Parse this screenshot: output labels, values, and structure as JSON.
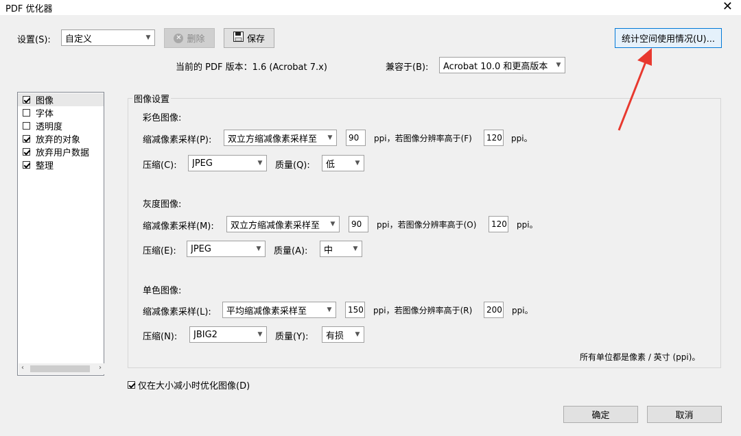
{
  "window": {
    "title": "PDF 优化器",
    "close_glyph": "✕"
  },
  "top": {
    "settings_label": "设置(S):",
    "settings_value": "自定义",
    "delete_label": "删除",
    "save_label": "保存",
    "audit_label": "统计空间使用情况(U)...",
    "current_version": "当前的 PDF 版本：1.6 (Acrobat 7.x)",
    "compat_label": "兼容于(B):",
    "compat_value": "Acrobat 10.0 和更高版本"
  },
  "panels": [
    {
      "label": "图像",
      "checked": true,
      "selected": true
    },
    {
      "label": "字体",
      "checked": false,
      "selected": false
    },
    {
      "label": "透明度",
      "checked": false,
      "selected": false
    },
    {
      "label": "放弃的对象",
      "checked": true,
      "selected": false
    },
    {
      "label": "放弃用户数据",
      "checked": true,
      "selected": false
    },
    {
      "label": "整理",
      "checked": true,
      "selected": false
    }
  ],
  "image_settings": {
    "group_title": "图像设置",
    "color": {
      "heading": "彩色图像:",
      "downsample_label": "缩减像素采样(P):",
      "downsample_value": "双立方缩减像素采样至",
      "ppi": "90",
      "ppi_unit_text": "ppi，若图像分辨率高于(F)",
      "above": "120",
      "above_unit": "ppi。",
      "compression_label": "压缩(C):",
      "compression_value": "JPEG",
      "quality_label": "质量(Q):",
      "quality_value": "低"
    },
    "gray": {
      "heading": "灰度图像:",
      "downsample_label": "缩减像素采样(M):",
      "downsample_value": "双立方缩减像素采样至",
      "ppi": "90",
      "ppi_unit_text": "ppi，若图像分辨率高于(O)",
      "above": "120",
      "above_unit": "ppi。",
      "compression_label": "压缩(E):",
      "compression_value": "JPEG",
      "quality_label": "质量(A):",
      "quality_value": "中"
    },
    "mono": {
      "heading": "单色图像:",
      "downsample_label": "缩减像素采样(L):",
      "downsample_value": "平均缩减像素采样至",
      "ppi": "150",
      "ppi_unit_text": "ppi，若图像分辨率高于(R)",
      "above": "200",
      "above_unit": "ppi。",
      "compression_label": "压缩(N):",
      "compression_value": "JBIG2",
      "quality_label": "质量(Y):",
      "quality_value": "有损"
    },
    "units_note": "所有单位都是像素 / 英寸 (ppi)。"
  },
  "optimize_only_if_smaller": {
    "label": "仅在大小减小时优化图像(D)",
    "checked": true
  },
  "buttons": {
    "ok": "确定",
    "cancel": "取消"
  },
  "colors": {
    "accent": "#0078d7",
    "annotation_arrow": "#e8392f"
  }
}
